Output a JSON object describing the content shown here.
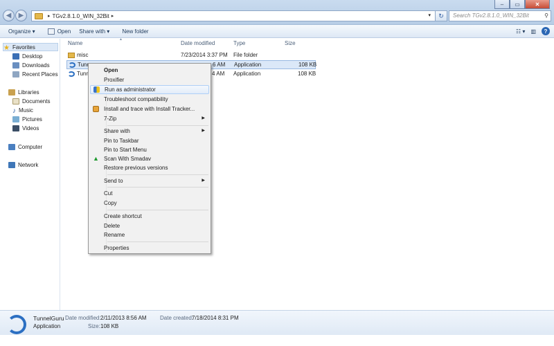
{
  "address": {
    "path": [
      "TGv2.8.1.0_WIN_32Bit"
    ],
    "search_placeholder": "Search TGv2.8.1.0_WIN_32Bit"
  },
  "toolbar": {
    "organize": "Organize ▾",
    "open": "Open",
    "share_with": "Share with ▾",
    "new_folder": "New folder"
  },
  "nav": {
    "favorites": "Favorites",
    "desktop": "Desktop",
    "downloads": "Downloads",
    "recent_places": "Recent Places",
    "libraries": "Libraries",
    "documents": "Documents",
    "music": "Music",
    "pictures": "Pictures",
    "videos": "Videos",
    "computer": "Computer",
    "network": "Network"
  },
  "columns": {
    "name": "Name",
    "date_modified": "Date modified",
    "type": "Type",
    "size": "Size"
  },
  "files": [
    {
      "name": "misc",
      "date": "7/23/2014 3:37 PM",
      "type": "File folder",
      "size": ""
    },
    {
      "name": "Tunn",
      "date": "",
      "type": "Application",
      "size": "108 KB",
      "date_visible": "6 AM"
    },
    {
      "name": "Tunn",
      "date": "",
      "type": "Application",
      "size": "108 KB",
      "date_visible": "4 AM"
    }
  ],
  "context_menu": {
    "open": "Open",
    "proxifier": "Proxifier",
    "run_as_admin": "Run as administrator",
    "troubleshoot": "Troubleshoot compatibility",
    "install_tracker": "Install and trace with Install Tracker...",
    "seven_zip": "7-Zip",
    "share_with": "Share with",
    "pin_taskbar": "Pin to Taskbar",
    "pin_start": "Pin to Start Menu",
    "scan_smadav": "Scan With Smadav",
    "restore": "Restore previous versions",
    "send_to": "Send to",
    "cut": "Cut",
    "copy": "Copy",
    "create_shortcut": "Create shortcut",
    "delete": "Delete",
    "rename": "Rename",
    "properties": "Properties"
  },
  "details": {
    "name": "TunnelGuru",
    "type": "Application",
    "date_modified_label": "Date modified:",
    "date_modified": "2/11/2013 8:56 AM",
    "size_label": "Size:",
    "size": "108 KB",
    "date_created_label": "Date created:",
    "date_created": "7/18/2014 8:31 PM"
  },
  "colors": {
    "selection": "#dbe8f8",
    "accent": "#2b6fc2"
  }
}
